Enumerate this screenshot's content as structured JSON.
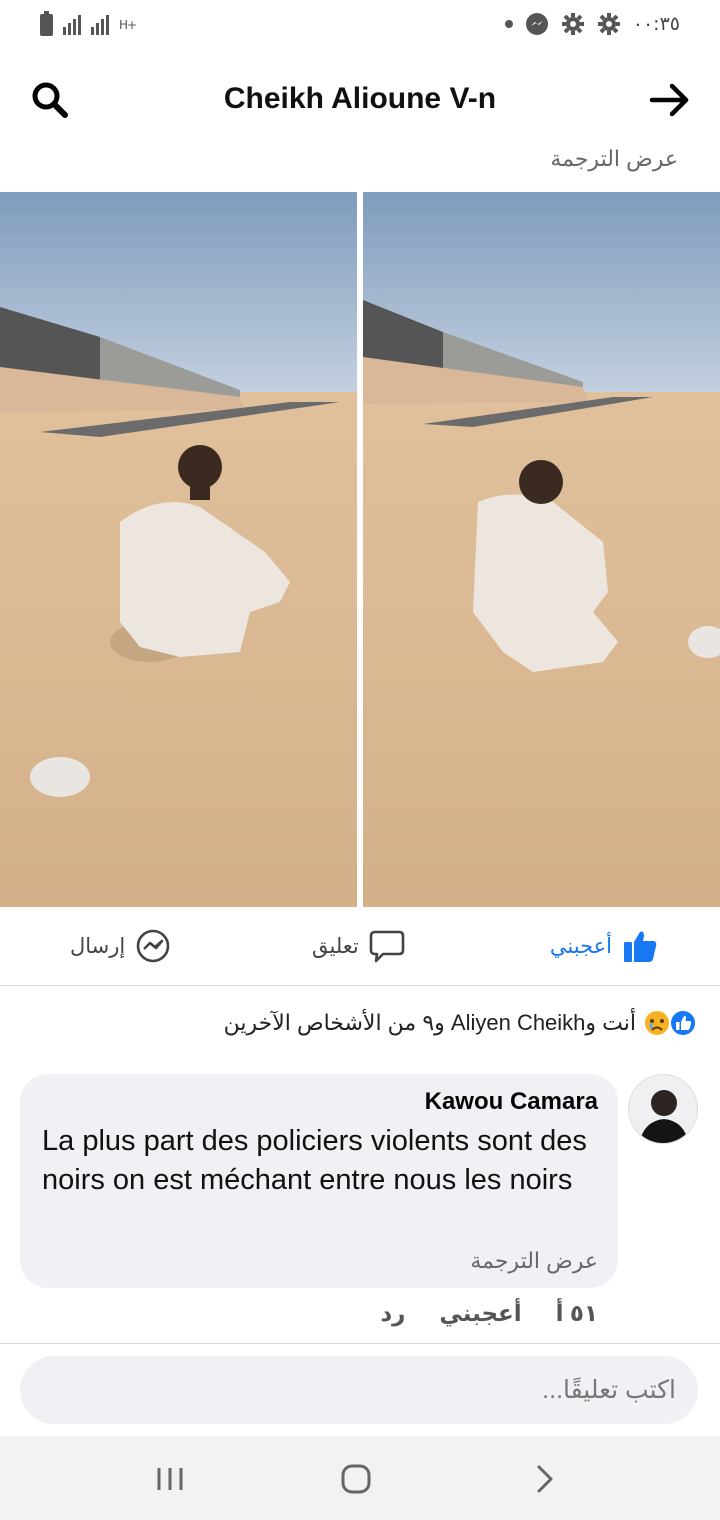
{
  "status_bar": {
    "time": "٠٠:٣٥",
    "network_label": "H+"
  },
  "header": {
    "title": "Cheikh Alioune V-n"
  },
  "post": {
    "see_translation": "عرض الترجمة",
    "actions": {
      "like_label": "أعجبني",
      "comment_label": "تعليق",
      "send_label": "إرسال"
    },
    "reactions_text": "أنت وAliyen Cheikh و٩ من الأشخاص الآخرين"
  },
  "comment": {
    "author": "Kawou Camara",
    "text": "La plus part des policiers violents sont des noirs on est méchant entre nous les noirs",
    "see_translation": "عرض الترجمة",
    "time": "٥١ أ",
    "like_label": "أعجبني",
    "reply_label": "رد"
  },
  "composer": {
    "placeholder": "اكتب تعليقًا..."
  },
  "colors": {
    "accent": "#1877f2",
    "bubble": "#eff1f4",
    "secondary_text": "#65676b"
  }
}
